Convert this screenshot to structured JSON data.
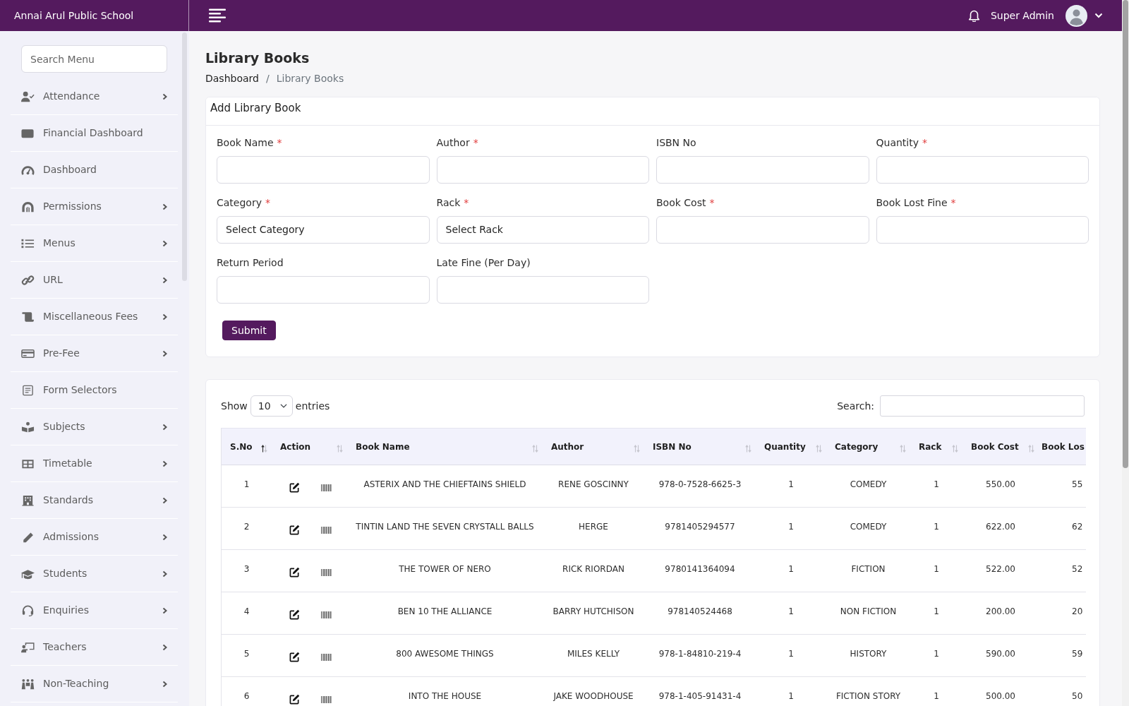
{
  "topbar": {
    "brand": "Annai Arul Public School",
    "user_name": "Super Admin"
  },
  "sidebar": {
    "search_placeholder": "Search Menu",
    "items": [
      {
        "label": "Attendance",
        "has_submenu": true
      },
      {
        "label": "Financial Dashboard",
        "has_submenu": false
      },
      {
        "label": "Dashboard",
        "has_submenu": false
      },
      {
        "label": "Permissions",
        "has_submenu": true
      },
      {
        "label": "Menus",
        "has_submenu": true
      },
      {
        "label": "URL",
        "has_submenu": true
      },
      {
        "label": "Miscellaneous Fees",
        "has_submenu": true
      },
      {
        "label": "Pre-Fee",
        "has_submenu": true
      },
      {
        "label": "Form Selectors",
        "has_submenu": false
      },
      {
        "label": "Subjects",
        "has_submenu": true
      },
      {
        "label": "Timetable",
        "has_submenu": true
      },
      {
        "label": "Standards",
        "has_submenu": true
      },
      {
        "label": "Admissions",
        "has_submenu": true
      },
      {
        "label": "Students",
        "has_submenu": true
      },
      {
        "label": "Enquiries",
        "has_submenu": true
      },
      {
        "label": "Teachers",
        "has_submenu": true
      },
      {
        "label": "Non-Teaching",
        "has_submenu": true
      }
    ]
  },
  "page": {
    "title": "Library Books",
    "breadcrumb": [
      {
        "label": "Dashboard",
        "current": false
      },
      {
        "label": "Library Books",
        "current": true
      }
    ],
    "breadcrumb_separator": "/"
  },
  "form": {
    "title": "Add Library Book",
    "fields": [
      {
        "label": "Book Name",
        "required_mark": "*",
        "kind": "input"
      },
      {
        "label": "Author",
        "required_mark": "*",
        "kind": "input"
      },
      {
        "label": "ISBN No",
        "kind": "input"
      },
      {
        "label": "Quantity",
        "required_mark": "*",
        "kind": "input"
      },
      {
        "label": "Category",
        "required_mark": "*",
        "kind": "select",
        "value": "Select Category"
      },
      {
        "label": "Rack",
        "required_mark": "*",
        "kind": "select",
        "value": "Select Rack"
      },
      {
        "label": "Book Cost",
        "required_mark": "*",
        "kind": "input"
      },
      {
        "label": "Book Lost Fine",
        "required_mark": "*",
        "kind": "input"
      },
      {
        "label": "Return Period",
        "kind": "input"
      },
      {
        "label": "Late Fine (Per Day)",
        "kind": "input"
      }
    ],
    "submit": "Submit"
  },
  "books_table": {
    "length_label_before": "Show",
    "page_length": "10",
    "length_label_after": "entries",
    "search_label": "Search:",
    "columns": [
      {
        "label": "S.No",
        "sorted": true
      },
      {
        "label": "Action",
        "sorted": false
      },
      {
        "label": "Book Name",
        "sorted": false
      },
      {
        "label": "Author",
        "sorted": false
      },
      {
        "label": "ISBN No",
        "sorted": false
      },
      {
        "label": "Quantity",
        "sorted": false
      },
      {
        "label": "Category",
        "sorted": false
      },
      {
        "label": "Rack",
        "sorted": false
      },
      {
        "label": "Book Cost",
        "sorted": false
      },
      {
        "label": "Book Los"
      }
    ],
    "rows": [
      {
        "sno": "1",
        "book_name": "ASTERIX AND THE CHIEFTAINS SHIELD",
        "author": "RENE GOSCINNY",
        "isbn": "978-0-7528-6625-3",
        "quantity": "1",
        "category": "COMEDY",
        "rack": "1",
        "book_cost": "550.00",
        "book_lost_fine": "55"
      },
      {
        "sno": "2",
        "book_name": "TINTIN LAND THE SEVEN CRYSTALL BALLS",
        "author": "HERGE",
        "isbn": "9781405294577",
        "quantity": "1",
        "category": "COMEDY",
        "rack": "1",
        "book_cost": "622.00",
        "book_lost_fine": "62"
      },
      {
        "sno": "3",
        "book_name": "THE TOWER OF NERO",
        "author": "RICK RIORDAN",
        "isbn": "9780141364094",
        "quantity": "1",
        "category": "FICTION",
        "rack": "1",
        "book_cost": "522.00",
        "book_lost_fine": "52"
      },
      {
        "sno": "4",
        "book_name": "BEN 10 THE ALLIANCE",
        "author": "BARRY HUTCHISON",
        "isbn": "978140524468",
        "quantity": "1",
        "category": "NON FICTION",
        "rack": "1",
        "book_cost": "200.00",
        "book_lost_fine": "20"
      },
      {
        "sno": "5",
        "book_name": "800 AWESOME THINGS",
        "author": "MILES KELLY",
        "isbn": "978-1-84810-219-4",
        "quantity": "1",
        "category": "HISTORY",
        "rack": "1",
        "book_cost": "590.00",
        "book_lost_fine": "59"
      },
      {
        "sno": "6",
        "book_name": "INTO THE HOUSE",
        "author": "JAKE WOODHOUSE",
        "isbn": "978-1-405-91431-4",
        "quantity": "1",
        "category": "FICTION STORY",
        "rack": "1",
        "book_cost": "500.00",
        "book_lost_fine": "50"
      }
    ]
  }
}
